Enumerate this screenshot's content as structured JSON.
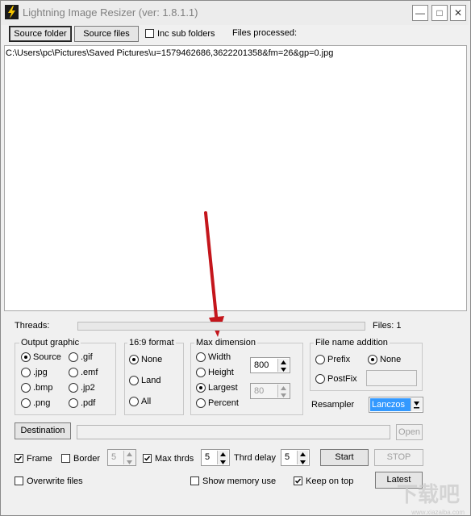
{
  "window": {
    "title": "Lightning Image Resizer (ver: 1.8.1.1)",
    "minimize_glyph": "—",
    "maximize_glyph": "□",
    "close_glyph": "✕"
  },
  "toolbar": {
    "source_folder": "Source folder",
    "source_files": "Source files",
    "inc_sub_folders": "Inc sub folders",
    "files_processed": "Files processed:"
  },
  "file_list": {
    "items": [
      "C:\\Users\\pc\\Pictures\\Saved Pictures\\u=1579462686,3622201358&fm=26&gp=0.jpg"
    ]
  },
  "status": {
    "threads_label": "Threads:",
    "files_label": "Files: 1"
  },
  "output_graphic": {
    "title": "Output graphic",
    "options": [
      "Source",
      ".gif",
      ".jpg",
      ".emf",
      ".bmp",
      ".jp2",
      ".png",
      ".pdf"
    ],
    "selected": "Source"
  },
  "format_169": {
    "title": "16:9 format",
    "options": [
      "None",
      "Land",
      "All"
    ],
    "selected": "None"
  },
  "max_dimension": {
    "title": "Max dimension",
    "options": [
      "Width",
      "Height",
      "Largest",
      "Percent"
    ],
    "selected": "Largest",
    "dimension_value": "800",
    "percent_value": "80"
  },
  "file_name_addition": {
    "title": "File name addition",
    "prefix": "Prefix",
    "none": "None",
    "postfix": "PostFix",
    "selected": "None",
    "postfix_text": ""
  },
  "resampler": {
    "label": "Resampler",
    "value": "Lanczos"
  },
  "destination": {
    "button": "Destination",
    "path": "",
    "open": "Open"
  },
  "options_row": {
    "frame": "Frame",
    "border": "Border",
    "border_value": "5",
    "max_thrds": "Max thrds",
    "max_thrds_value": "5",
    "thrd_delay": "Thrd delay",
    "thrd_delay_value": "5",
    "start": "Start",
    "stop": "STOP"
  },
  "bottom_row": {
    "overwrite": "Overwrite files",
    "show_memory": "Show memory use",
    "keep_on_top": "Keep on top",
    "latest": "Latest"
  },
  "watermark": {
    "text": "下载吧",
    "url": "www.xiazaiba.com"
  },
  "colors": {
    "annotation_arrow": "#c4161c",
    "selection": "#3399ff"
  }
}
